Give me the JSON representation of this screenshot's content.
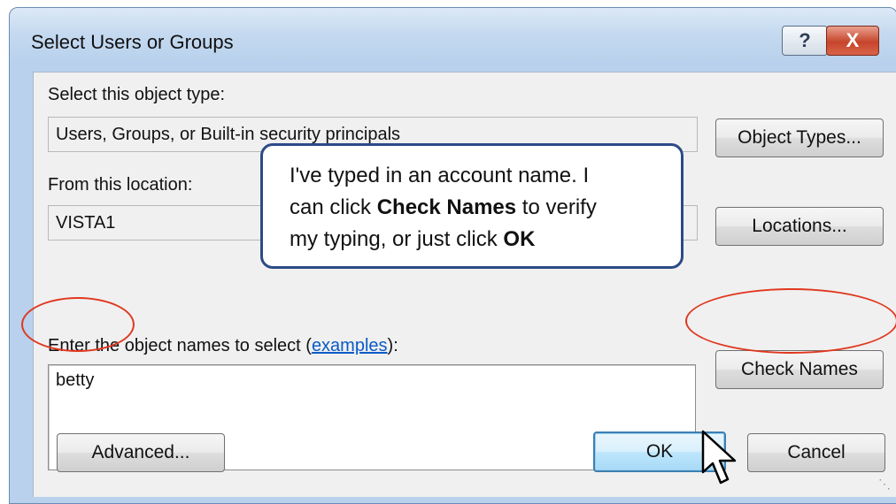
{
  "window": {
    "title": "Select Users or Groups",
    "help_label": "?",
    "close_label": "X"
  },
  "object_type": {
    "label": "Select this object type:",
    "value": "Users, Groups, or Built-in security principals",
    "button": "Object Types..."
  },
  "location": {
    "label": "From this location:",
    "value": "VISTA1",
    "button": "Locations..."
  },
  "names": {
    "label_prefix": "Enter the object names to select (",
    "label_link": "examples",
    "label_suffix": "):",
    "value": "betty",
    "check_button": "Check Names"
  },
  "footer": {
    "advanced_button": "Advanced...",
    "ok_button": "OK",
    "cancel_button": "Cancel"
  },
  "callout": {
    "line1": "I've typed in an account name.  I",
    "line2_pre": "can click ",
    "line2_bold": "Check Names",
    "line2_post": " to verify",
    "line3_pre": "my typing, or just click ",
    "line3_bold": "OK"
  },
  "colors": {
    "annotation_oval": "#e0381f",
    "callout_border": "#2b4a86",
    "link": "#0b5ac7"
  }
}
